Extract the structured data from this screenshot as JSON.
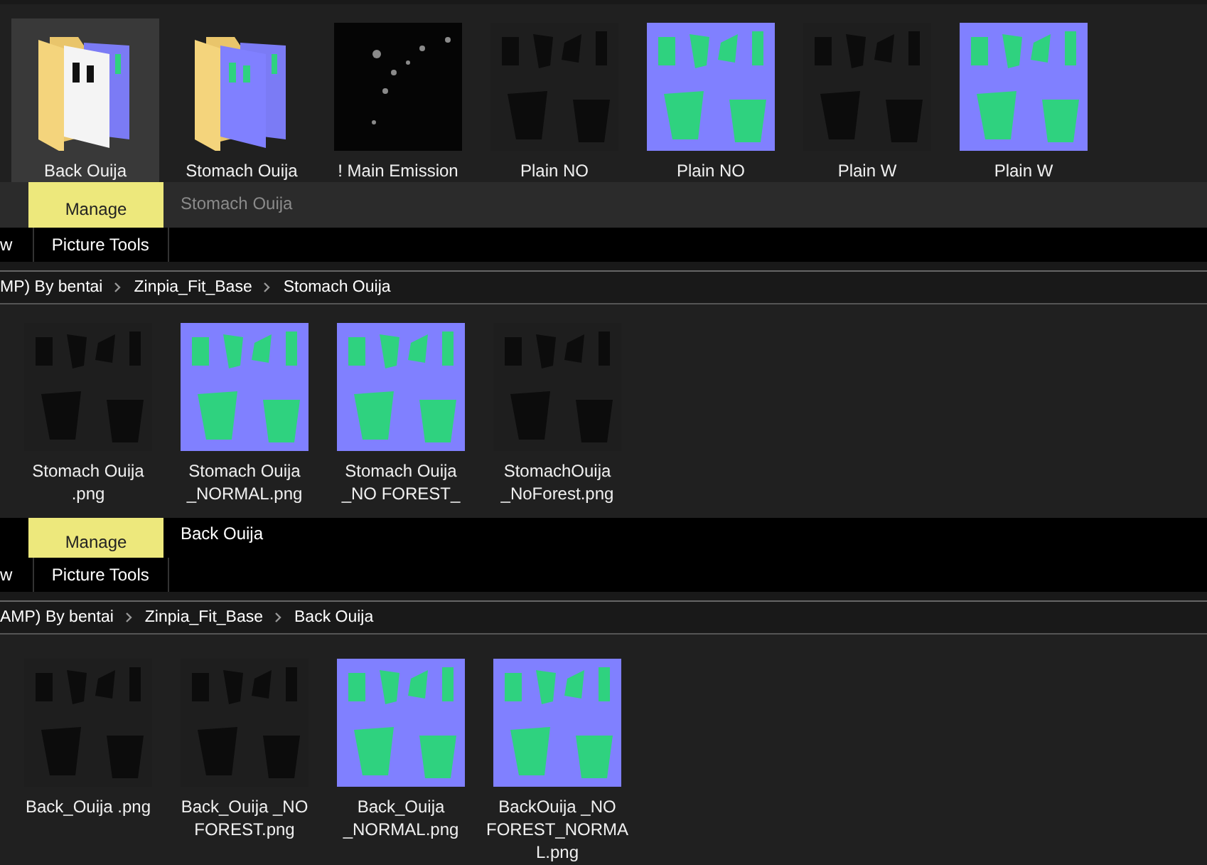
{
  "windows": [
    {
      "items": [
        {
          "label": "Back Ouija",
          "kind": "mask-folder",
          "selected": true
        },
        {
          "label": "Stomach Ouija",
          "kind": "normal-folder",
          "selected": false
        },
        {
          "label": "! Main Emission",
          "kind": "emission",
          "selected": false
        },
        {
          "label": "Plain NO",
          "kind": "mask",
          "selected": false
        },
        {
          "label": "Plain NO",
          "kind": "normal",
          "selected": false
        },
        {
          "label": "Plain W",
          "kind": "mask",
          "selected": false
        },
        {
          "label": "Plain W",
          "kind": "normal",
          "selected": false
        }
      ]
    },
    {
      "ribbon": {
        "active": false,
        "context_tab": "Manage",
        "title": "Stomach Ouija",
        "tabs": [
          "w",
          "Picture Tools"
        ]
      },
      "breadcrumb": [
        "MP) By bentai",
        "Zinpia_Fit_Base",
        "Stomach Ouija"
      ],
      "items": [
        {
          "label": "Stomach Ouija .png",
          "kind": "mask",
          "selected": false
        },
        {
          "label": "Stomach Ouija _NORMAL.png",
          "kind": "normal",
          "selected": false
        },
        {
          "label": "Stomach Ouija _NO FOREST_",
          "kind": "normal",
          "selected": false
        },
        {
          "label": "StomachOuija _NoForest.png",
          "kind": "mask",
          "selected": false
        }
      ]
    },
    {
      "ribbon": {
        "active": true,
        "context_tab": "Manage",
        "title": "Back Ouija",
        "tabs": [
          "w",
          "Picture Tools"
        ]
      },
      "breadcrumb": [
        "AMP) By bentai",
        "Zinpia_Fit_Base",
        "Back Ouija"
      ],
      "items": [
        {
          "label": "Back_Ouija .png",
          "kind": "mask",
          "selected": false
        },
        {
          "label": "Back_Ouija _NO FOREST.png",
          "kind": "mask",
          "selected": false
        },
        {
          "label": "Back_Ouija _NORMAL.png",
          "kind": "normal",
          "selected": false
        },
        {
          "label": "BackOuija _NO FOREST_NORMAL.png",
          "kind": "normal",
          "selected": false
        }
      ]
    }
  ]
}
